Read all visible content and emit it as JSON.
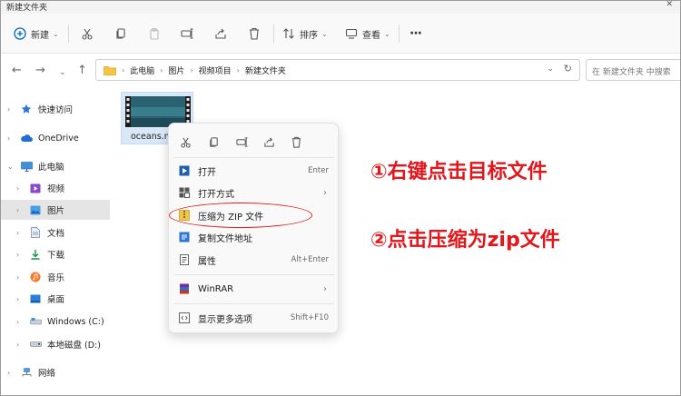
{
  "window": {
    "title": "新建文件夹",
    "close_glyph": "✕"
  },
  "toolbar": {
    "new_label": "新建",
    "sort_label": "排序",
    "view_label": "查看",
    "more_glyph": "···",
    "caret_glyph": "⌄"
  },
  "nav": {
    "back": "←",
    "forward": "→",
    "history": "⌄",
    "up": "↑"
  },
  "address": {
    "breadcrumbs": [
      "此电脑",
      "图片",
      "视频项目",
      "新建文件夹"
    ],
    "separator": "›",
    "dropdown_glyph": "⌄",
    "refresh_glyph": "↻"
  },
  "search": {
    "placeholder": "在 新建文件夹 中搜索"
  },
  "sidebar": {
    "items": [
      {
        "label": "快速访问",
        "expander": "›",
        "icon": "star-icon"
      },
      {
        "label": "OneDrive",
        "expander": "›",
        "icon": "cloud-icon"
      },
      {
        "label": "此电脑",
        "expander": "⌄",
        "icon": "pc-icon"
      },
      {
        "label": "视频",
        "expander": "›",
        "icon": "video-icon"
      },
      {
        "label": "图片",
        "expander": "›",
        "icon": "pictures-icon"
      },
      {
        "label": "文档",
        "expander": "›",
        "icon": "document-icon"
      },
      {
        "label": "下载",
        "expander": "›",
        "icon": "download-icon"
      },
      {
        "label": "音乐",
        "expander": "›",
        "icon": "music-icon"
      },
      {
        "label": "桌面",
        "expander": "›",
        "icon": "desktop-icon"
      },
      {
        "label": "Windows (C:)",
        "expander": "›",
        "icon": "drive-icon"
      },
      {
        "label": "本地磁盘 (D:)",
        "expander": "›",
        "icon": "drive-icon"
      },
      {
        "label": "网络",
        "expander": "›",
        "icon": "network-icon"
      }
    ],
    "selected_index": 4
  },
  "file": {
    "name": "oceans.m"
  },
  "context_menu": {
    "items": [
      {
        "label": "打开",
        "shortcut": "Enter",
        "icon": "open-icon"
      },
      {
        "label": "打开方式",
        "submenu_arrow": "›",
        "icon": "open-with-icon"
      },
      {
        "label": "压缩为 ZIP 文件",
        "icon": "zip-icon"
      },
      {
        "label": "复制文件地址",
        "icon": "copy-path-icon"
      },
      {
        "label": "属性",
        "shortcut": "Alt+Enter",
        "icon": "properties-icon"
      },
      {
        "label": "WinRAR",
        "submenu_arrow": "›",
        "icon": "winrar-icon"
      },
      {
        "label": "显示更多选项",
        "shortcut": "Shift+F10",
        "icon": "more-options-icon"
      }
    ],
    "highlighted_item": "压缩为 ZIP 文件"
  },
  "annotations": {
    "step1": "①右键点击目标文件",
    "step2": "②点击压缩为zip文件"
  },
  "colors": {
    "accent": "#0067c0",
    "annotation_red": "#e3161b",
    "selection": "#e5e5e5",
    "file_selected": "#d9e8f8"
  }
}
